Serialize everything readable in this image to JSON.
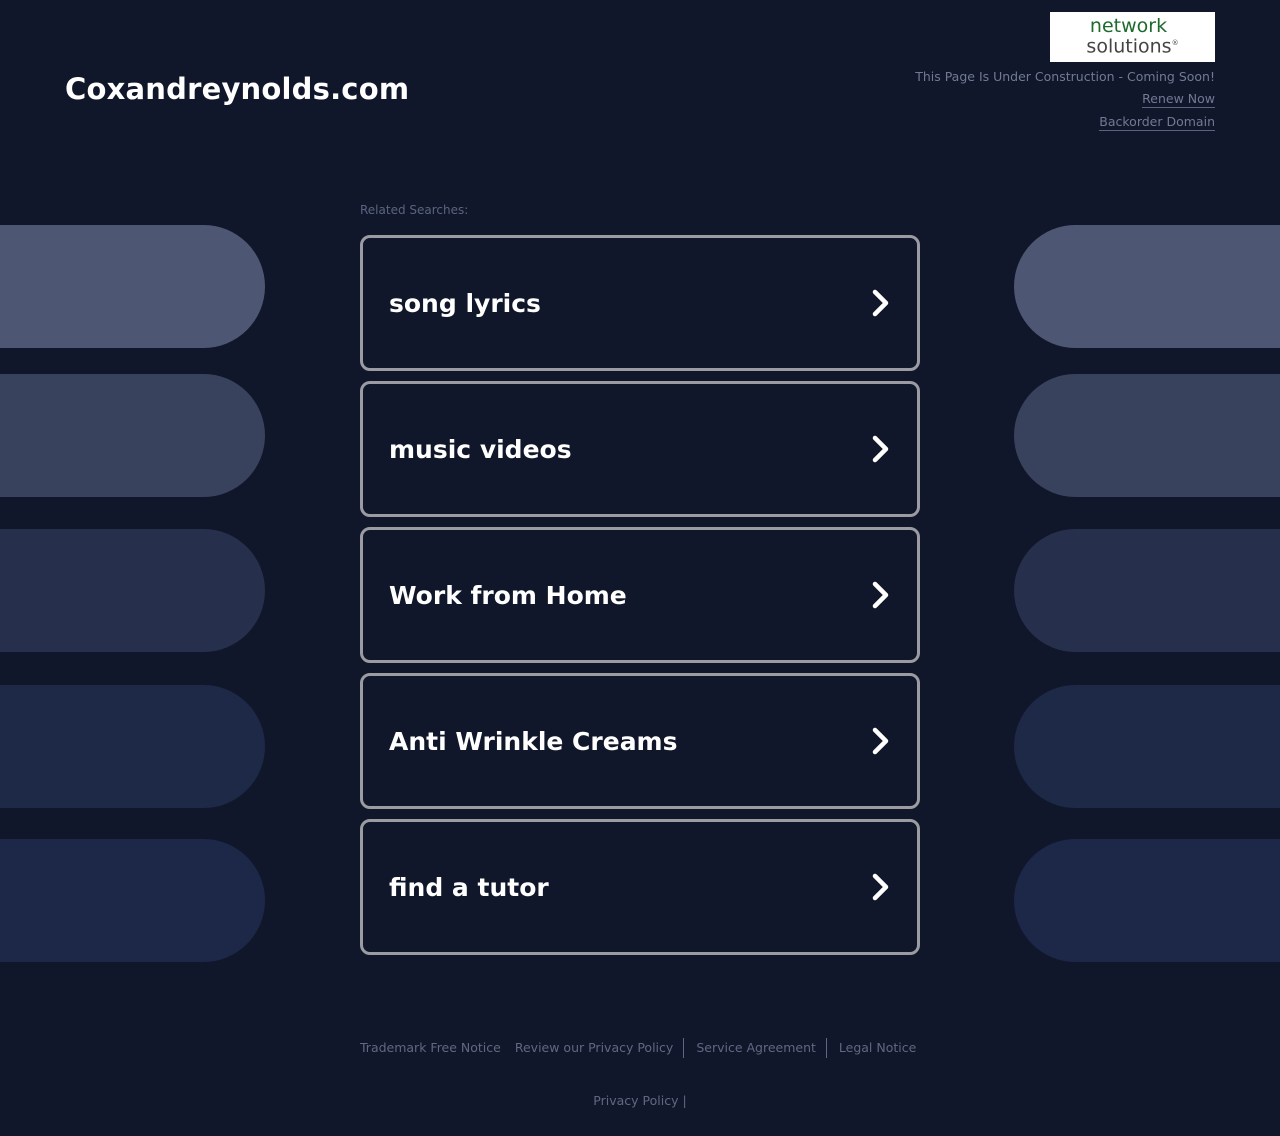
{
  "header": {
    "site_title": "Coxandreynolds.com",
    "brand_logo": {
      "line1": "network",
      "line2": "solutions",
      "mark": "®"
    },
    "notice": "This Page Is Under Construction - Coming Soon!",
    "renew_link": "Renew Now",
    "backorder_link": "Backorder Domain"
  },
  "related": {
    "label": "Related Searches:",
    "items": [
      {
        "label": "song lyrics",
        "icon": "chevron-right-icon"
      },
      {
        "label": "music videos",
        "icon": "chevron-right-icon"
      },
      {
        "label": "Work from Home",
        "icon": "chevron-right-icon"
      },
      {
        "label": "Anti Wrinkle Creams",
        "icon": "chevron-right-icon"
      },
      {
        "label": "find a tutor",
        "icon": "chevron-right-icon"
      }
    ]
  },
  "decor": {
    "pill_colors": [
      "#4d5773",
      "#39425d",
      "#262f4c",
      "#1e2847",
      "#1d2748"
    ]
  },
  "footer": {
    "links": [
      "Trademark Free Notice",
      "Review our Privacy Policy",
      "Service Agreement",
      "Legal Notice"
    ],
    "privacy_policy": "Privacy Policy",
    "privacy_sep": "|"
  },
  "colors": {
    "background": "#11172a",
    "card_border": "#9a9ca2",
    "muted_text": "#707a94",
    "brand_green": "#1d6b2c"
  }
}
